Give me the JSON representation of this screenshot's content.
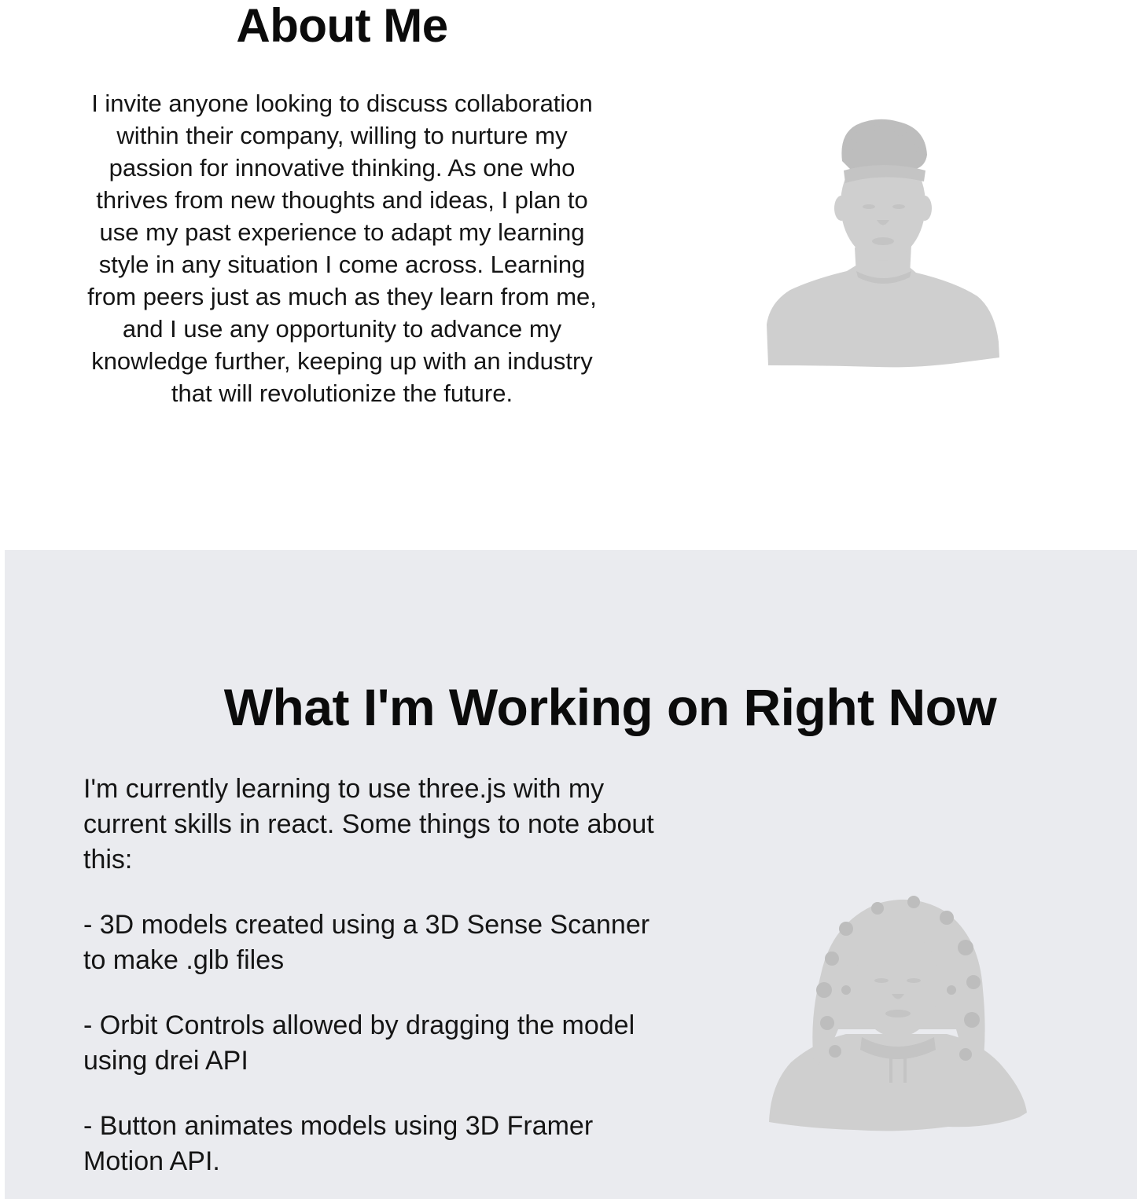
{
  "about": {
    "title": "About Me",
    "body": "I invite anyone looking to discuss collaboration within their company, willing to nurture my passion for innovative thinking. As one who thrives from new thoughts and ideas, I plan to use my past experience to adapt my learning style in any situation I come across. Learning from peers just as much as they learn from me, and I use any opportunity to advance my knowledge further, keeping up with an industry that will revolutionize the future."
  },
  "working": {
    "title": "What I'm Working on Right Now",
    "intro": "I'm currently learning to use three.js with my current skills in react. Some things to note about this:",
    "notes": [
      "- 3D models created using a 3D Sense Scanner to make .glb files",
      "- Orbit Controls allowed by dragging the model using drei API",
      "- Button animates models using 3D Framer Motion API."
    ]
  },
  "colors": {
    "background": "#ffffff",
    "section_background": "#eaebef",
    "model": "#cfcfcf",
    "text": "#0b0b0b"
  }
}
